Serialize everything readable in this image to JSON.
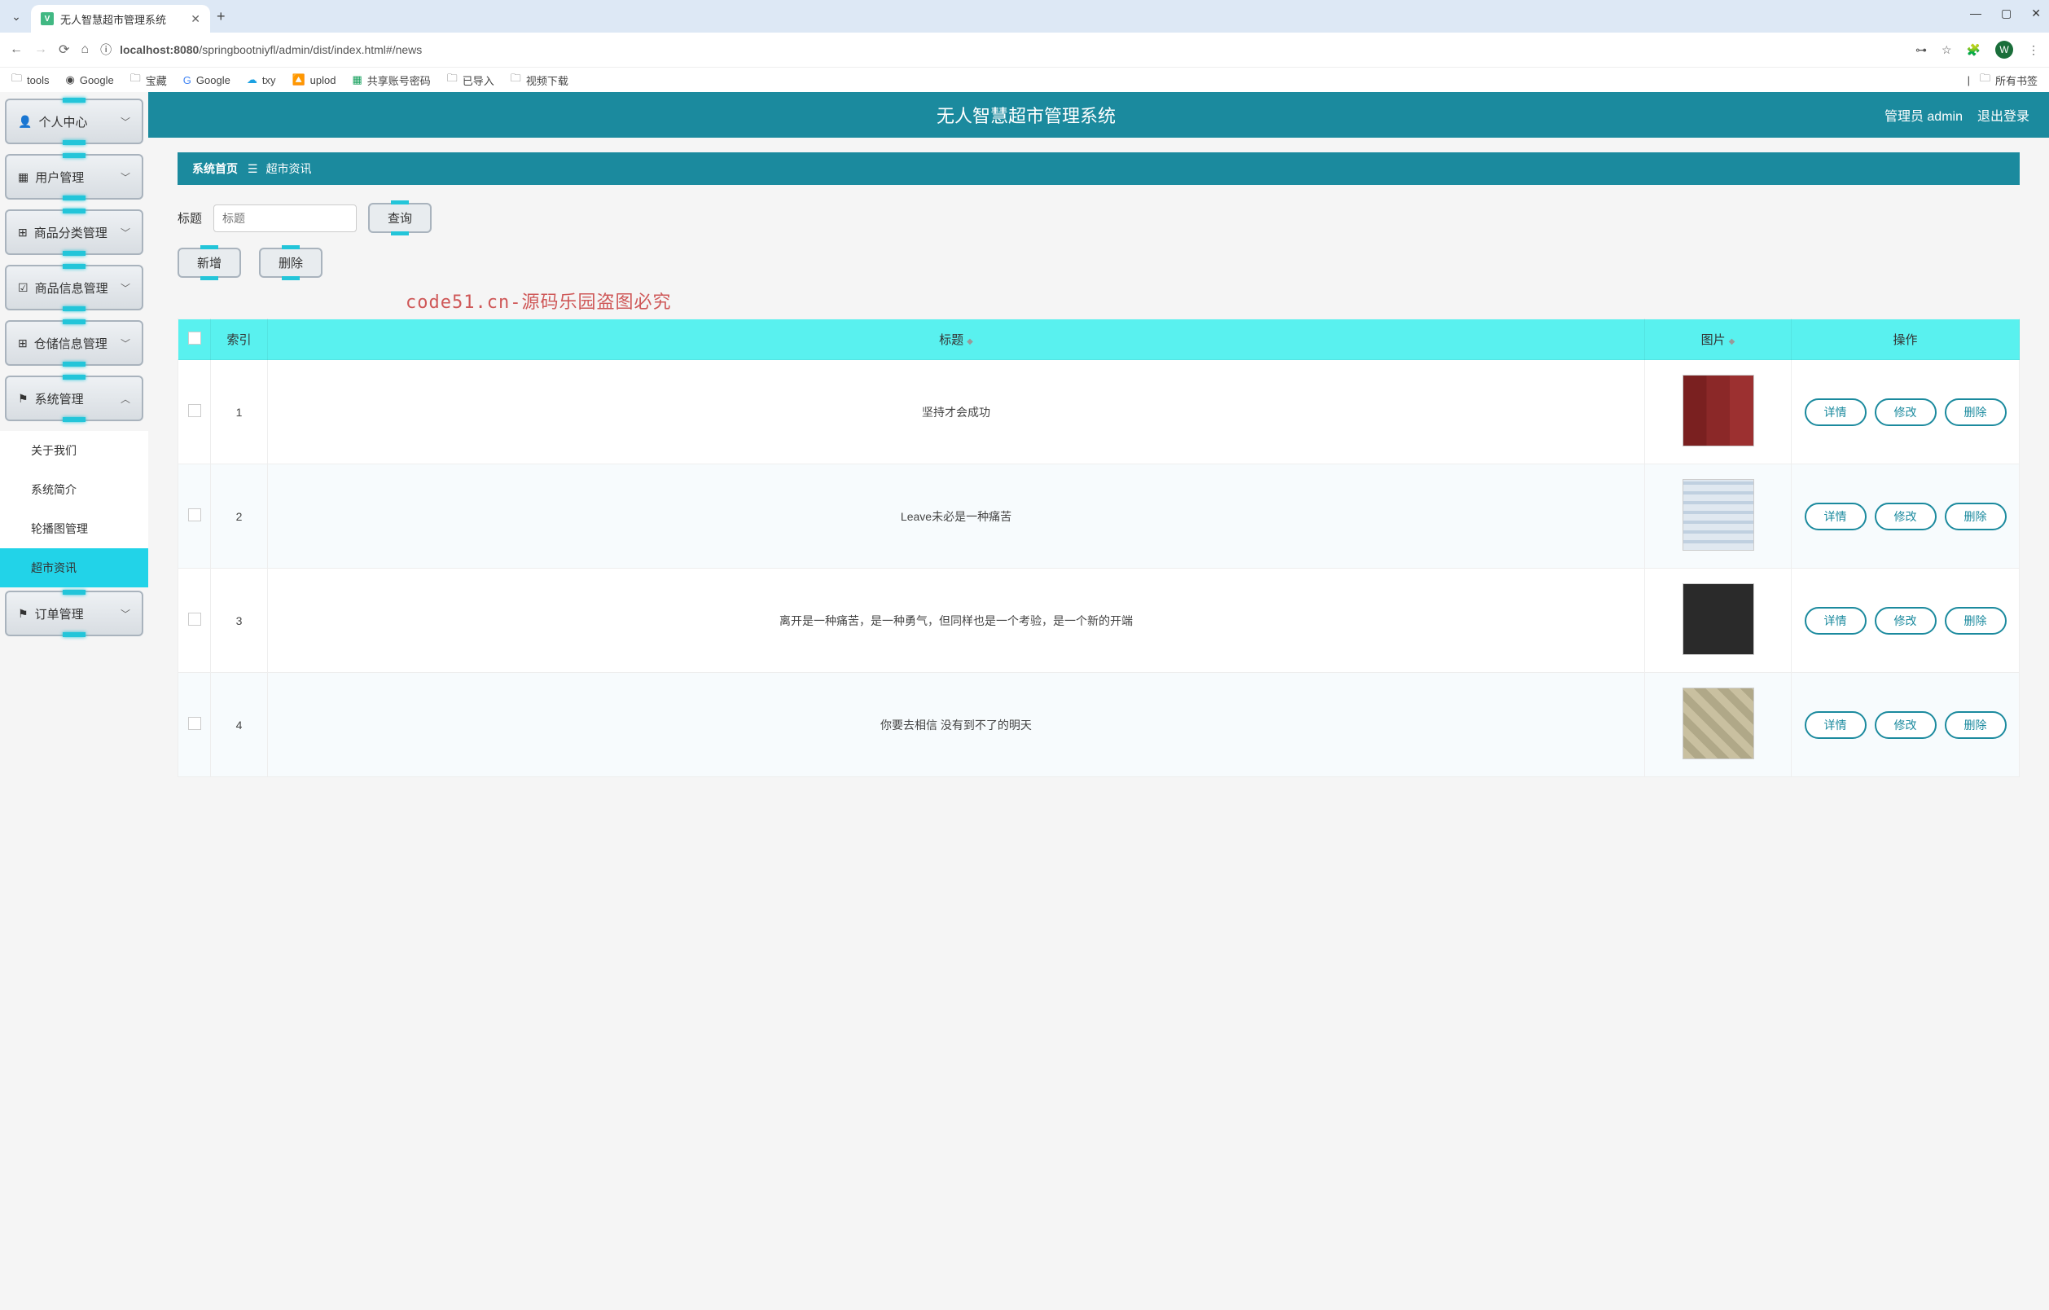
{
  "browser": {
    "tab_title": "无人智慧超市管理系统",
    "url_host": "localhost:8080",
    "url_path": "/springbootniyfl/admin/dist/index.html#/news",
    "profile_letter": "W",
    "bookmarks": [
      "tools",
      "Google",
      "宝藏",
      "Google",
      "txy",
      "uplod",
      "共享账号密码",
      "已导入",
      "视频下载"
    ],
    "all_bookmarks": "所有书签"
  },
  "header": {
    "title": "无人智慧超市管理系统",
    "role": "管理员",
    "username": "admin",
    "logout": "退出登录"
  },
  "sidebar": {
    "items": [
      {
        "icon": "person",
        "label": "个人中心",
        "arrow": "down"
      },
      {
        "icon": "grid",
        "label": "用户管理",
        "arrow": "down"
      },
      {
        "icon": "grid4",
        "label": "商品分类管理",
        "arrow": "down"
      },
      {
        "icon": "check",
        "label": "商品信息管理",
        "arrow": "down"
      },
      {
        "icon": "grid4",
        "label": "仓储信息管理",
        "arrow": "down"
      },
      {
        "icon": "flag",
        "label": "系统管理",
        "arrow": "up"
      },
      {
        "icon": "flag",
        "label": "订单管理",
        "arrow": "down"
      }
    ],
    "submenu": [
      {
        "label": "关于我们",
        "active": false
      },
      {
        "label": "系统简介",
        "active": false
      },
      {
        "label": "轮播图管理",
        "active": false
      },
      {
        "label": "超市资讯",
        "active": true
      }
    ]
  },
  "breadcrumb": {
    "home": "系统首页",
    "current": "超市资讯"
  },
  "search": {
    "label": "标题",
    "placeholder": "标题",
    "button": "查询"
  },
  "actions": {
    "add": "新增",
    "delete": "删除"
  },
  "watermark": "code51.cn-源码乐园盗图必究",
  "table": {
    "columns": [
      "",
      "索引",
      "标题",
      "图片",
      "操作"
    ],
    "row_actions": {
      "detail": "详情",
      "edit": "修改",
      "delete": "删除"
    },
    "rows": [
      {
        "index": "1",
        "title": "坚持才会成功",
        "img": "books"
      },
      {
        "index": "2",
        "title": "Leave未必是一种痛苦",
        "img": "web"
      },
      {
        "index": "3",
        "title": "离开是一种痛苦，是一种勇气，但同样也是一个考验，是一个新的开端",
        "img": "necklace"
      },
      {
        "index": "4",
        "title": "你要去相信 没有到不了的明天",
        "img": "misc"
      }
    ]
  }
}
